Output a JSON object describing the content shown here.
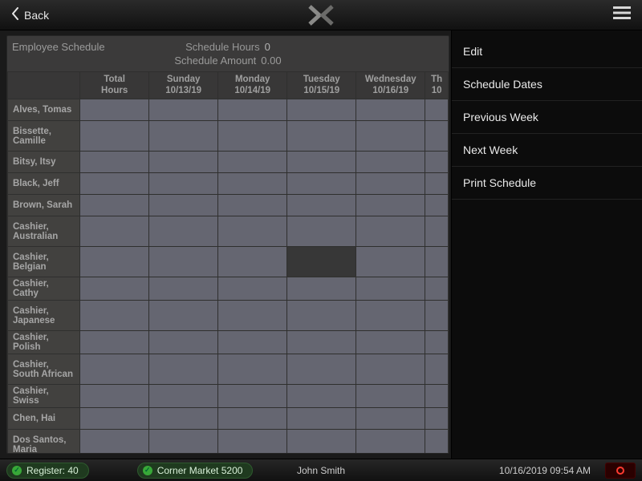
{
  "topbar": {
    "back_label": "Back"
  },
  "schedule": {
    "title": "Employee Schedule",
    "hours_label": "Schedule Hours",
    "hours_value": "0",
    "amount_label": "Schedule Amount",
    "amount_value": "0.00",
    "columns": [
      {
        "line1": "Total",
        "line2": "Hours"
      },
      {
        "line1": "Sunday",
        "line2": "10/13/19"
      },
      {
        "line1": "Monday",
        "line2": "10/14/19"
      },
      {
        "line1": "Tuesday",
        "line2": "10/15/19"
      },
      {
        "line1": "Wednesday",
        "line2": "10/16/19"
      },
      {
        "line1": "Th",
        "line2": "10"
      }
    ],
    "employees": [
      "Alves, Tomas",
      "Bissette, Camille",
      "Bitsy, Itsy",
      "Black, Jeff",
      "Brown, Sarah",
      "Cashier, Australian",
      "Cashier, Belgian",
      "Cashier, Cathy",
      "Cashier, Japanese",
      "Cashier, Polish",
      "Cashier, South African",
      "Cashier, Swiss",
      "Chen, Hai",
      "Dos Santos, Maria"
    ],
    "tall_rows": [
      1,
      5,
      6,
      8,
      10,
      13
    ],
    "dark_cell": {
      "row": 6,
      "col": 3
    }
  },
  "menu": {
    "items": [
      "Edit",
      "Schedule Dates",
      "Previous Week",
      "Next Week",
      "Print Schedule"
    ]
  },
  "statusbar": {
    "register_label": "Register: 40",
    "store_label": "Corner Market 5200",
    "user": "John Smith",
    "datetime": "10/16/2019 09:54 AM"
  }
}
